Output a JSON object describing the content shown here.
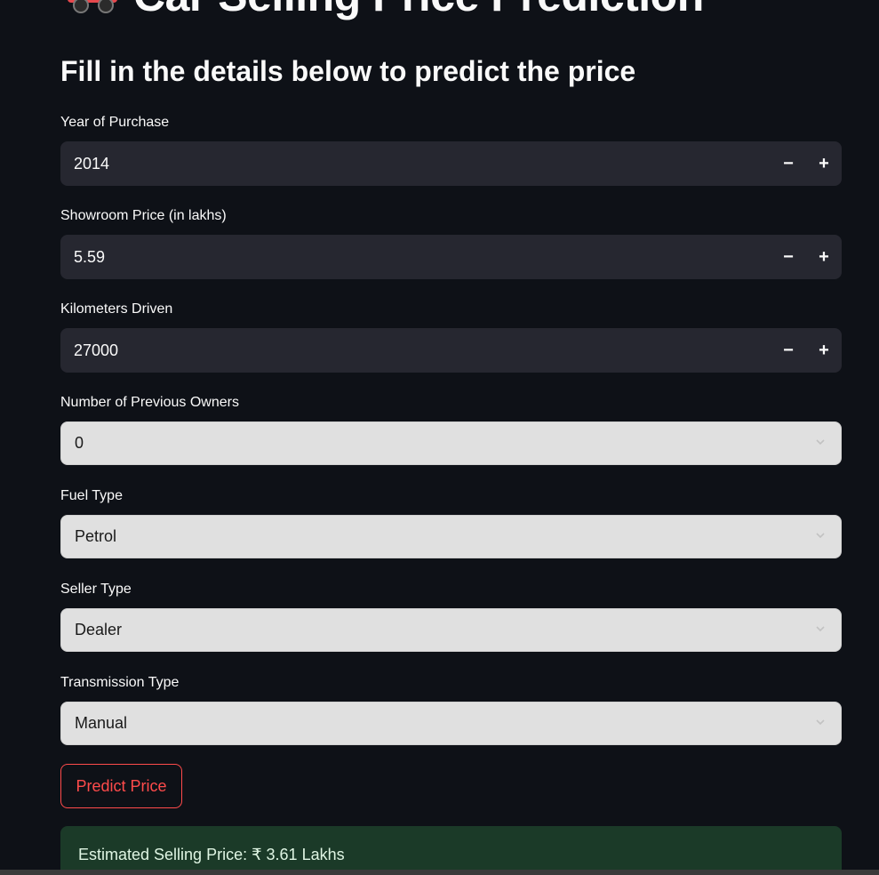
{
  "header": {
    "title": "Car Selling Price Prediction",
    "subtitle": "Fill in the details below to predict the price"
  },
  "form": {
    "year": {
      "label": "Year of Purchase",
      "value": "2014"
    },
    "showroom_price": {
      "label": "Showroom Price (in lakhs)",
      "value": "5.59"
    },
    "kms_driven": {
      "label": "Kilometers Driven",
      "value": "27000"
    },
    "owners": {
      "label": "Number of Previous Owners",
      "value": "0"
    },
    "fuel_type": {
      "label": "Fuel Type",
      "value": "Petrol"
    },
    "seller_type": {
      "label": "Seller Type",
      "value": "Dealer"
    },
    "transmission": {
      "label": "Transmission Type",
      "value": "Manual"
    },
    "stepper_minus": "−",
    "stepper_plus": "+"
  },
  "actions": {
    "predict_label": "Predict Price"
  },
  "result": {
    "text": "Estimated Selling Price: ₹ 3.61 Lakhs"
  },
  "colors": {
    "background": "#0e1117",
    "input_bg": "#262730",
    "select_bg": "#e0e0e0",
    "accent": "#ff4b4b",
    "success_bg": "#1b3a28"
  },
  "icons": {
    "title_icon": "car-icon",
    "select_icon": "chevron-down-icon"
  }
}
